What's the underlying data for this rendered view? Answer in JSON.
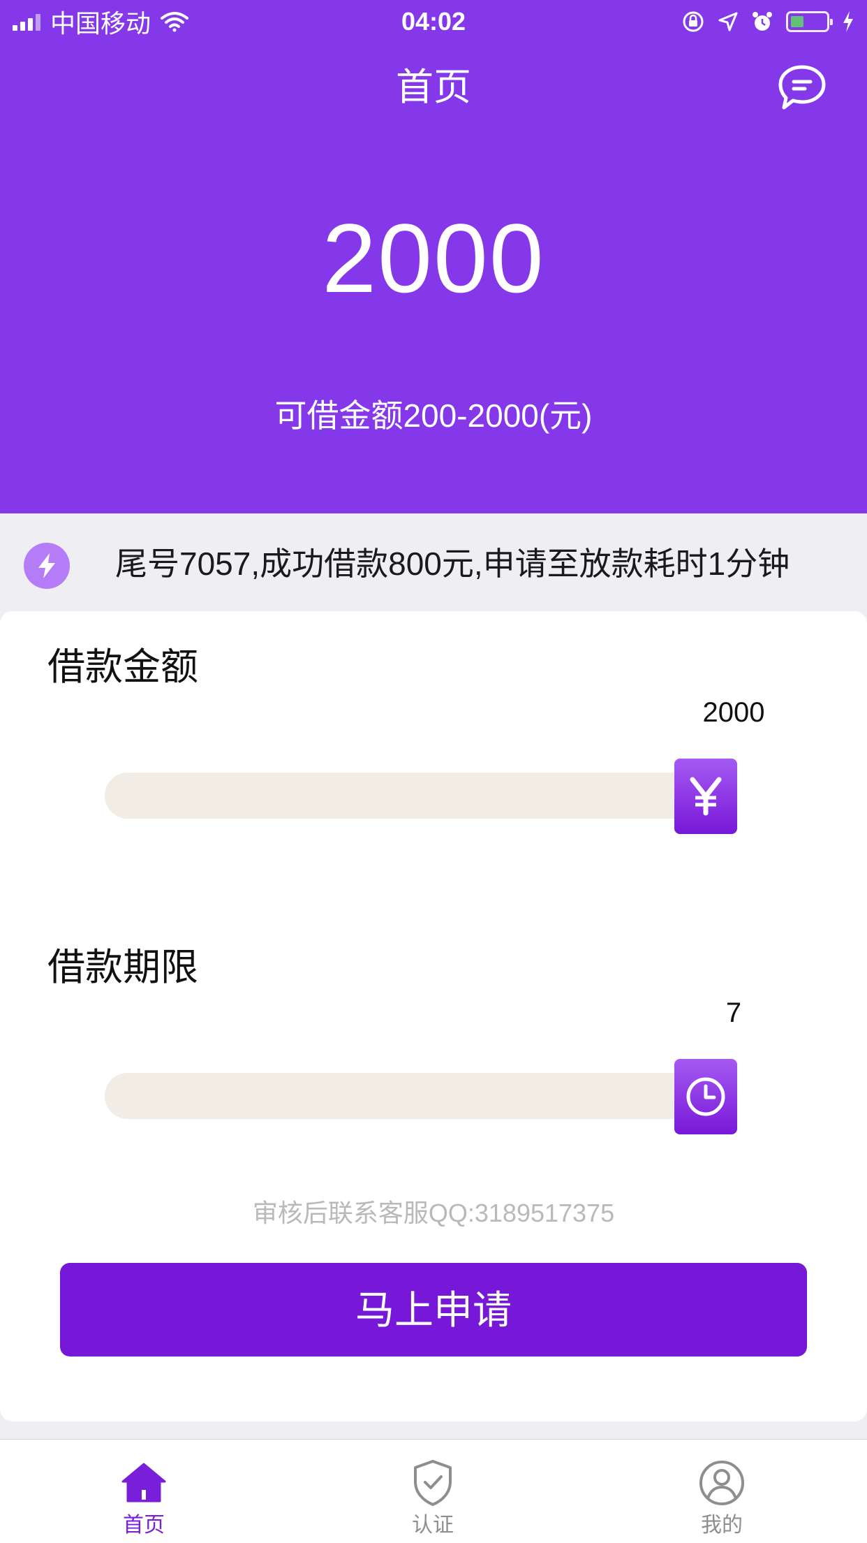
{
  "status_bar": {
    "carrier": "中国移动",
    "time": "04:02"
  },
  "header": {
    "title": "首页",
    "amount": "2000",
    "range": "可借金额200-2000(元)"
  },
  "notice": {
    "text": "尾号7057,成功借款800元,申请至放款耗时1分钟"
  },
  "loan_amount": {
    "title": "借款金额",
    "value": "2000",
    "slider_fraction": 1.0,
    "thumb_icon": "yen-icon"
  },
  "loan_term": {
    "title": "借款期限",
    "value": "7",
    "slider_fraction": 1.0,
    "thumb_icon": "clock-icon"
  },
  "hint": "审核后联系客服QQ:3189517375",
  "apply_label": "马上申请",
  "tabs": [
    {
      "label": "首页",
      "icon": "home-icon",
      "active": true
    },
    {
      "label": "认证",
      "icon": "shield-check-icon",
      "active": false
    },
    {
      "label": "我的",
      "icon": "user-icon",
      "active": false
    }
  ],
  "colors": {
    "primary": "#8538ea",
    "button": "#7717d8",
    "tab_active": "#7a1fd9",
    "tab_inactive": "#8e8e8e"
  }
}
